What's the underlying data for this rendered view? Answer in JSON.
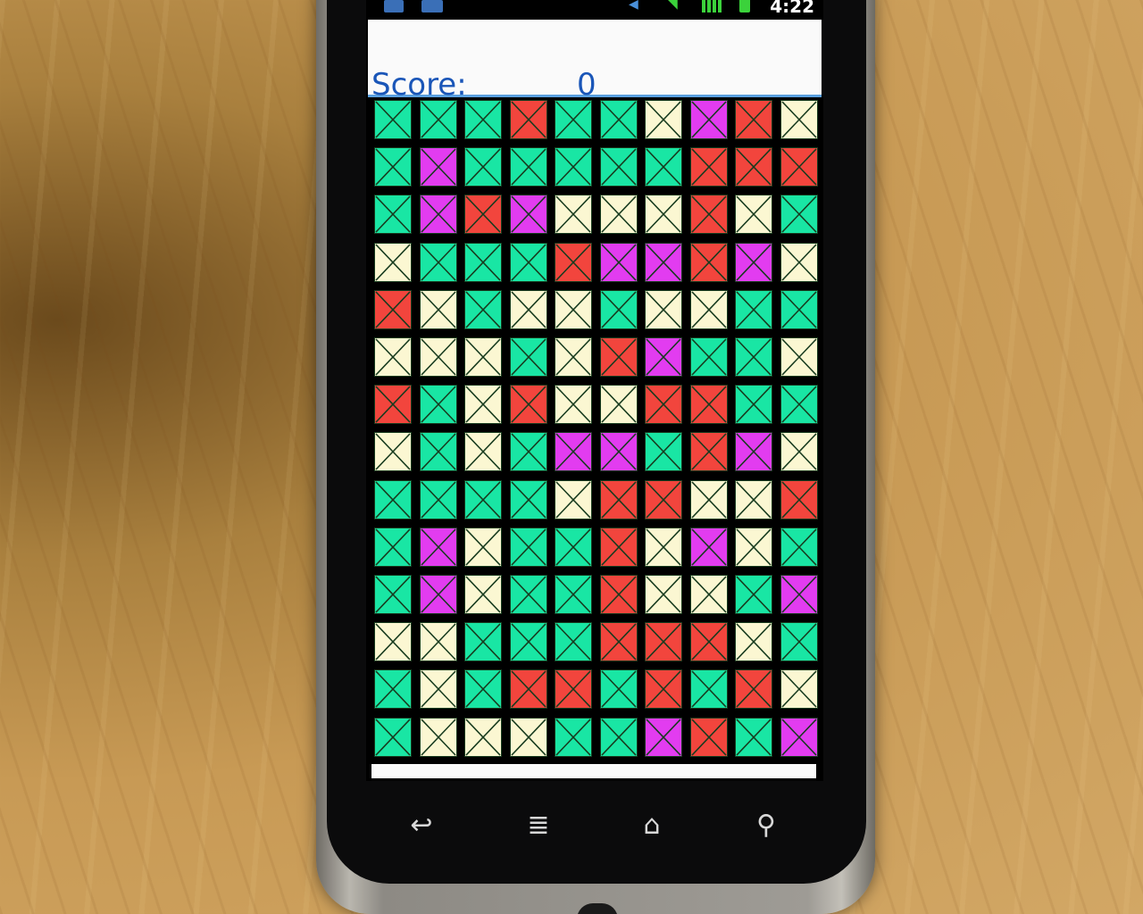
{
  "status_bar": {
    "time": "4:22",
    "icons": [
      "mail-icon",
      "chat-icon",
      "mute-icon",
      "wifi-icon",
      "signal-icon",
      "battery-icon"
    ]
  },
  "header": {
    "score_label": "Score:",
    "score_value": "0"
  },
  "board": {
    "columns": 10,
    "rows": 14,
    "tile_colors": {
      "G": "#19e6a4",
      "R": "#f2453d",
      "P": "#e23cf0",
      "W": "#fbf7d2"
    },
    "grid": [
      [
        "G",
        "G",
        "G",
        "R",
        "G",
        "G",
        "W",
        "P",
        "R",
        "W"
      ],
      [
        "G",
        "P",
        "G",
        "G",
        "G",
        "G",
        "G",
        "R",
        "R",
        "R"
      ],
      [
        "G",
        "P",
        "R",
        "P",
        "W",
        "W",
        "W",
        "R",
        "W",
        "G"
      ],
      [
        "W",
        "G",
        "G",
        "G",
        "R",
        "P",
        "P",
        "R",
        "P",
        "W"
      ],
      [
        "R",
        "W",
        "G",
        "W",
        "W",
        "G",
        "W",
        "W",
        "G",
        "G"
      ],
      [
        "W",
        "W",
        "W",
        "G",
        "W",
        "R",
        "P",
        "G",
        "G",
        "W"
      ],
      [
        "R",
        "G",
        "W",
        "R",
        "W",
        "W",
        "R",
        "R",
        "G",
        "G"
      ],
      [
        "W",
        "G",
        "W",
        "G",
        "P",
        "P",
        "G",
        "R",
        "P",
        "W"
      ],
      [
        "G",
        "G",
        "G",
        "G",
        "W",
        "R",
        "R",
        "W",
        "W",
        "R"
      ],
      [
        "G",
        "P",
        "W",
        "G",
        "G",
        "R",
        "W",
        "P",
        "W",
        "G"
      ],
      [
        "G",
        "P",
        "W",
        "G",
        "G",
        "R",
        "W",
        "W",
        "G",
        "P"
      ],
      [
        "W",
        "W",
        "G",
        "G",
        "G",
        "R",
        "R",
        "R",
        "W",
        "G"
      ],
      [
        "G",
        "W",
        "G",
        "R",
        "R",
        "G",
        "R",
        "G",
        "R",
        "W"
      ],
      [
        "G",
        "W",
        "W",
        "W",
        "G",
        "G",
        "P",
        "R",
        "G",
        "P"
      ]
    ]
  },
  "nav": {
    "buttons": [
      "back-icon",
      "menu-icon",
      "home-icon",
      "search-icon"
    ]
  }
}
